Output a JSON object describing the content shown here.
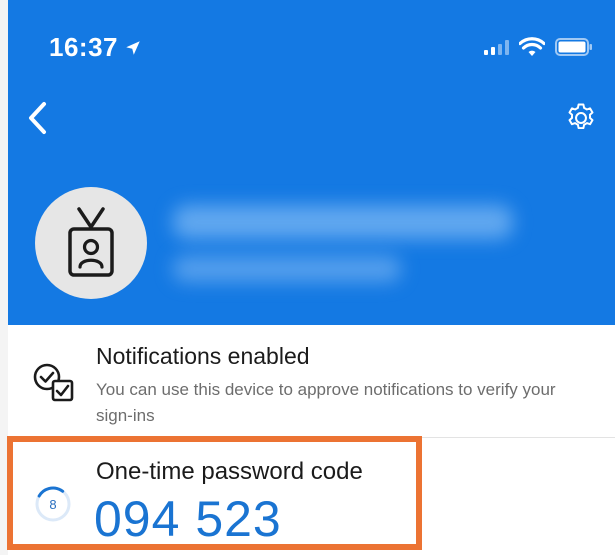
{
  "status_bar": {
    "time": "16:37"
  },
  "header": {
    "back_icon": "chevron-left-icon",
    "settings_icon": "gear-icon",
    "avatar_icon": "id-badge-icon",
    "account_name_redacted": true,
    "account_email_redacted": true
  },
  "notifications": {
    "icon": "check-circle-square-icon",
    "title": "Notifications enabled",
    "description": "You can use this device to approve notifications to verify your sign-ins"
  },
  "otp": {
    "title": "One-time password code",
    "code": "094 523",
    "timer_seconds": "8",
    "timer_fraction": 0.27
  },
  "colors": {
    "header_bg": "#1479e3",
    "code_color": "#1a74d2",
    "highlight_border": "#ec7333"
  }
}
